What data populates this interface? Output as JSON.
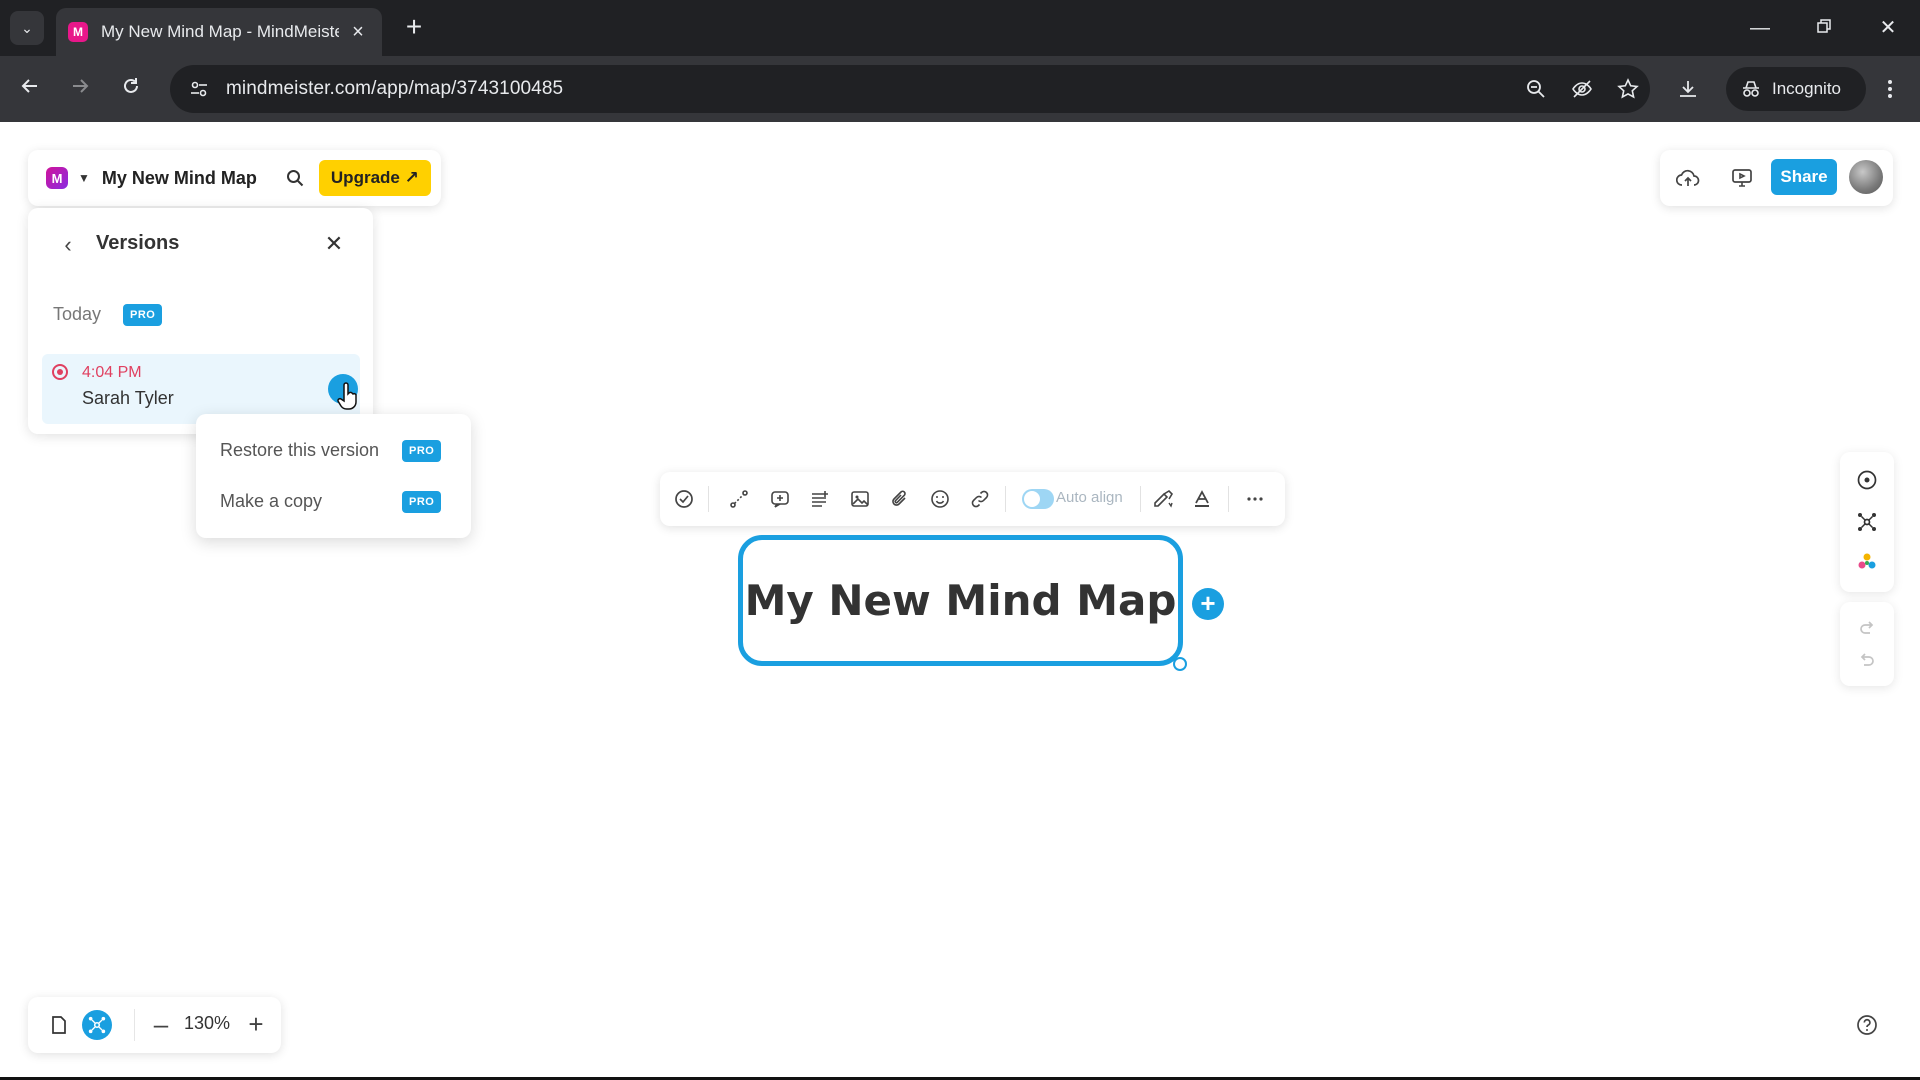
{
  "browser": {
    "tab_title": "My New Mind Map - MindMeister",
    "tab_favicon_letter": "M",
    "url": "mindmeister.com/app/map/3743100485",
    "profile_label": "Incognito"
  },
  "header": {
    "logo_letter": "M",
    "map_title": "My New Mind Map",
    "upgrade_label": "Upgrade ↗"
  },
  "top_right": {
    "share_label": "Share"
  },
  "versions_panel": {
    "title": "Versions",
    "group_label": "Today",
    "pro_badge": "PRO",
    "items": [
      {
        "time": "4:04 PM",
        "author": "Sarah Tyler"
      }
    ]
  },
  "version_menu": {
    "items": [
      {
        "label": "Restore this version",
        "badge": "PRO"
      },
      {
        "label": "Make a copy",
        "badge": "PRO"
      }
    ]
  },
  "node_toolbar": {
    "auto_align_label": "Auto align",
    "auto_align_on": true
  },
  "canvas": {
    "central_node_text": "My New Mind Map"
  },
  "zoom": {
    "level": "130%"
  },
  "colors": {
    "accent": "#1a9fe0",
    "upgrade": "#ffd000",
    "version_marker": "#e04060"
  }
}
